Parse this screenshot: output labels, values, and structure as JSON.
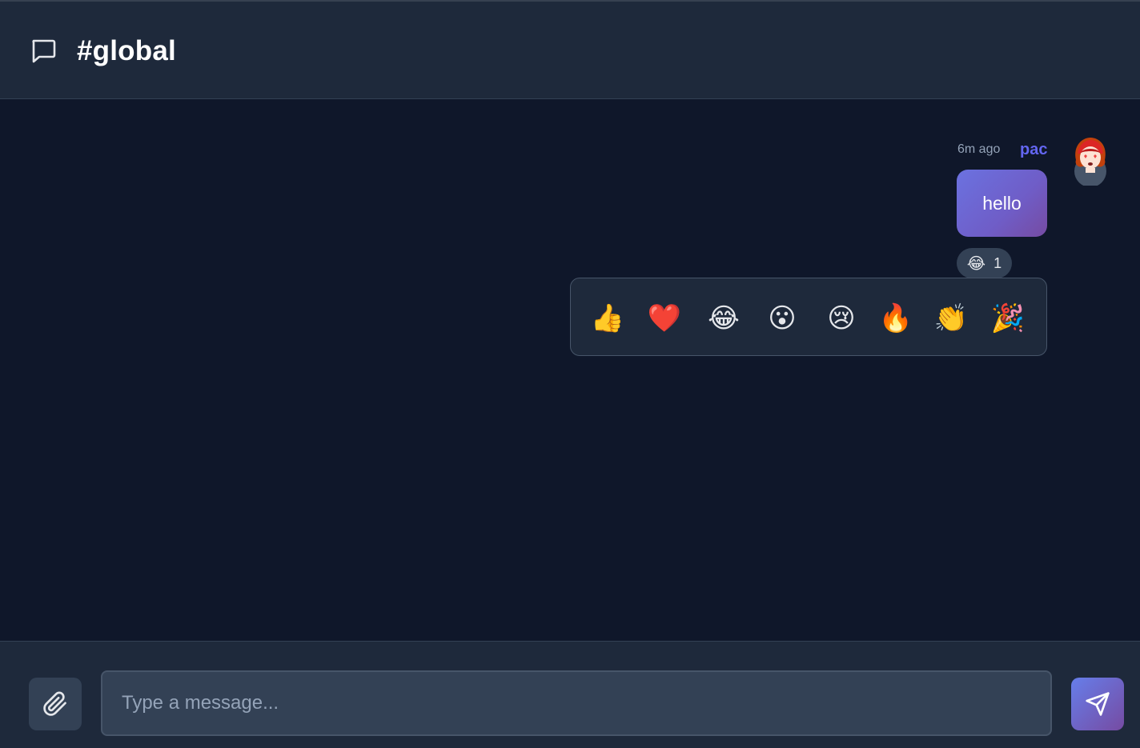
{
  "header": {
    "title": "#global",
    "icon": "chat-bubble-icon"
  },
  "messages": [
    {
      "time": "6m ago",
      "user": "pac",
      "avatar_icon": "avatar-red-hair-icon",
      "text": "hello",
      "reactions": [
        {
          "emoji": "😂",
          "count": "1"
        }
      ]
    }
  ],
  "reaction_picker": {
    "options": [
      "👍",
      "❤️",
      "😂",
      "😮",
      "😢",
      "🔥",
      "👏",
      "🎉"
    ]
  },
  "composer": {
    "placeholder": "Type a message...",
    "value": "",
    "attach_icon": "paperclip-icon",
    "send_icon": "send-icon"
  },
  "colors": {
    "background": "#0f172a",
    "panel": "#1e293b",
    "input": "#334155",
    "accent": "#6366f1",
    "gradient_start": "#667eea",
    "gradient_end": "#764ba2"
  }
}
